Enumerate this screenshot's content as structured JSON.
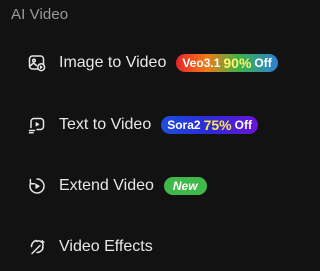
{
  "section": {
    "title": "AI Video"
  },
  "items": [
    {
      "label": "Image to Video",
      "icon": "image-to-video-icon",
      "badge": {
        "model": "Veo3.1",
        "percent": "90%",
        "suffix": "Off"
      }
    },
    {
      "label": "Text to Video",
      "icon": "text-to-video-icon",
      "badge": {
        "model": "Sora2",
        "percent": "75%",
        "suffix": "Off"
      }
    },
    {
      "label": "Extend Video",
      "icon": "extend-video-icon",
      "badge": {
        "text": "New"
      }
    },
    {
      "label": "Video Effects",
      "icon": "video-effects-icon"
    }
  ],
  "colors": {
    "background": "#121212",
    "section_title": "#9a9a9a",
    "item_text": "#e8e8e8",
    "new_badge": "#3fb94a"
  }
}
